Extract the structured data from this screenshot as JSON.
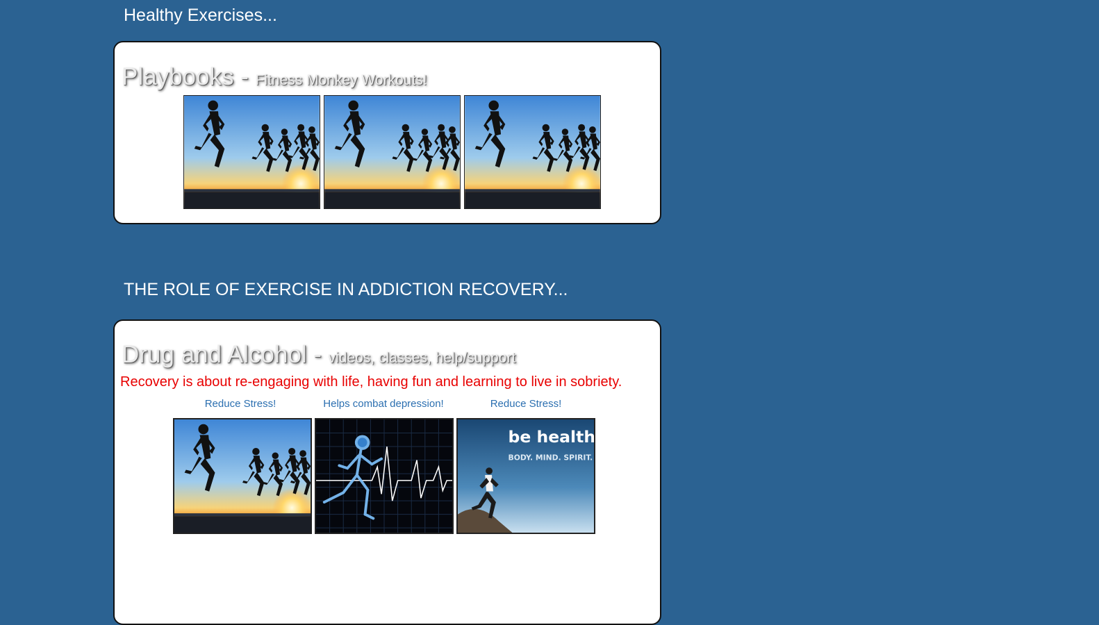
{
  "sections": [
    {
      "title": "Healthy Exercises...",
      "heading_main": "Playbooks - ",
      "heading_sub": "Fitness Monkey Workouts!",
      "images": [
        "runners-sunset-image",
        "runners-sunset-image",
        "runners-sunset-image"
      ]
    },
    {
      "title": "THE ROLE OF EXERCISE IN ADDICTION RECOVERY...",
      "heading_main": "Drug and Alcohol - ",
      "heading_sub": "videos, classes, help/support",
      "quote": "Recovery is about re-engaging with life, having fun and learning to live in sobriety.",
      "captions": [
        "Reduce Stress!",
        "Helps combat depression!",
        "Reduce Stress!"
      ],
      "images": [
        "runners-sunset-image",
        "xray-runner-heartbeat-image",
        "be-healthy-runner-image"
      ],
      "be_healthy_title": "be healthy",
      "be_healthy_sub": "BODY. MIND. SPIRIT."
    }
  ],
  "colors": {
    "background": "#2b6292",
    "quote": "#e80000",
    "caption_link": "#2b6fb0"
  }
}
